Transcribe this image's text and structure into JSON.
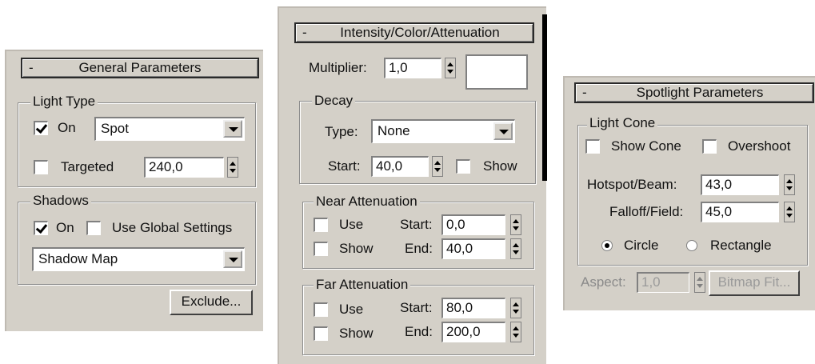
{
  "general": {
    "rollout_sign": "-",
    "title": "General Parameters",
    "light_type": {
      "group_label": "Light Type",
      "on_label": "On",
      "on_checked": true,
      "type_value": "Spot",
      "targeted_label": "Targeted",
      "targeted_checked": false,
      "target_distance": "240,0"
    },
    "shadows": {
      "group_label": "Shadows",
      "on_label": "On",
      "on_checked": true,
      "use_global_label": "Use Global Settings",
      "use_global_checked": false,
      "type_value": "Shadow Map"
    },
    "exclude_label": "Exclude..."
  },
  "intensity": {
    "rollout_sign": "-",
    "title": "Intensity/Color/Attenuation",
    "multiplier_label": "Multiplier:",
    "multiplier_value": "1,0",
    "color": "#ffffff",
    "decay": {
      "group_label": "Decay",
      "type_label": "Type:",
      "type_value": "None",
      "start_label": "Start:",
      "start_value": "40,0",
      "show_label": "Show",
      "show_checked": false
    },
    "near": {
      "group_label": "Near Attenuation",
      "use_label": "Use",
      "show_label": "Show",
      "start_label": "Start:",
      "start_value": "0,0",
      "end_label": "End:",
      "end_value": "40,0"
    },
    "far": {
      "group_label": "Far Attenuation",
      "use_label": "Use",
      "show_label": "Show",
      "start_label": "Start:",
      "start_value": "80,0",
      "end_label": "End:",
      "end_value": "200,0"
    }
  },
  "spotlight": {
    "rollout_sign": "-",
    "title": "Spotlight Parameters",
    "cone": {
      "group_label": "Light Cone",
      "show_cone_label": "Show Cone",
      "overshoot_label": "Overshoot",
      "hotspot_label": "Hotspot/Beam:",
      "hotspot_value": "43,0",
      "falloff_label": "Falloff/Field:",
      "falloff_value": "45,0",
      "circle_label": "Circle",
      "rectangle_label": "Rectangle",
      "circle_selected": true
    },
    "aspect_label": "Aspect:",
    "aspect_value": "1,0",
    "bitmap_fit_label": "Bitmap Fit..."
  }
}
